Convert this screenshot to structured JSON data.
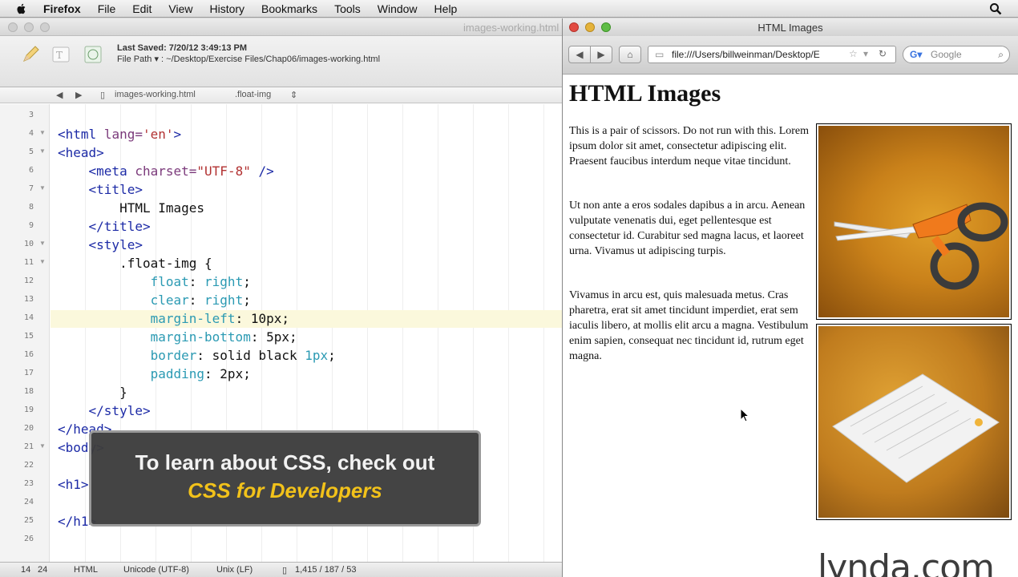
{
  "menubar": {
    "app_name": "Firefox",
    "items": [
      "File",
      "Edit",
      "View",
      "History",
      "Bookmarks",
      "Tools",
      "Window",
      "Help"
    ]
  },
  "editor": {
    "title": "images-working.html",
    "last_saved": "Last Saved: 7/20/12 3:49:13 PM",
    "file_path": "File Path ▾ : ~/Desktop/Exercise Files/Chap06/images-working.html",
    "pathbar": {
      "file": "images-working.html",
      "symbol": ".float-img"
    },
    "line_numbers": [
      "3",
      "4",
      "5",
      "6",
      "7",
      "8",
      "9",
      "10",
      "11",
      "12",
      "13",
      "14",
      "15",
      "16",
      "17",
      "18",
      "19",
      "20",
      "21",
      "22",
      "23",
      "24",
      "25",
      "26"
    ],
    "status": {
      "line": "14",
      "col": "24",
      "syntax": "HTML",
      "encoding": "Unicode (UTF-8)",
      "line_endings": "Unix (LF)",
      "stats": "1,415 / 187 / 53"
    }
  },
  "callout": {
    "line1": "To learn about CSS, check out",
    "line2": "CSS for Developers"
  },
  "browser": {
    "title": "HTML Images",
    "url": "file:///Users/billweinman/Desktop/E",
    "search_placeholder": "Google",
    "page": {
      "heading": "HTML Images",
      "paragraphs": [
        "This is a pair of scissors. Do not run with this. Lorem ipsum dolor sit amet, consectetur adipiscing elit. Praesent faucibus interdum neque vitae tincidunt.",
        "Ut non ante a eros sodales dapibus a in arcu. Aenean vulputate venenatis dui, eget pellentesque est consectetur id. Curabitur sed magna lacus, et laoreet urna. Vivamus ut adipiscing turpis.",
        "Vivamus in arcu est, quis malesuada metus. Cras pharetra, erat sit amet tincidunt imperdiet, erat sem iaculis libero, at mollis elit arcu a magna. Vestibulum enim sapien, consequat nec tincidunt id, rutrum eget magna."
      ]
    }
  },
  "watermark": "lynda.com"
}
